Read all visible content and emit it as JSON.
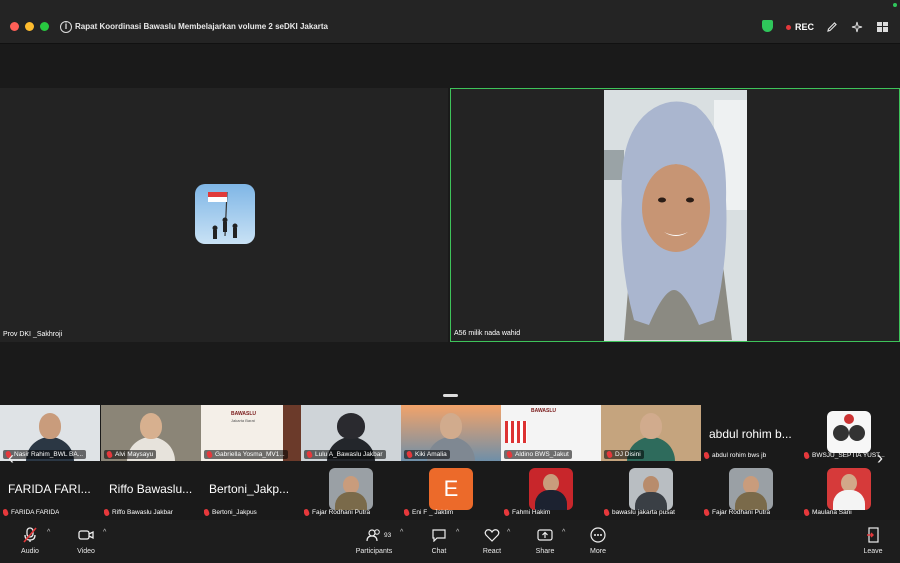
{
  "window": {
    "title": "Rapat Koordinasi Bawaslu Membelajarkan volume 2 seDKI Jakarta",
    "rec_label": "REC",
    "accent": "#3ec35a",
    "rec_color": "#e5383b"
  },
  "main_tiles": [
    {
      "name": "Prov DKI _Sakhroji"
    },
    {
      "name": "A56 milik nada wahid"
    }
  ],
  "gallery": {
    "row1": [
      "Nasir Rahim_BWL BA...",
      "Alvi Maysayu",
      "Gabriella Yosma_MV1...",
      "Lulu A_Bawaslu Jakbar",
      "Kiki Amalia",
      "Aldino BWS_Jakut",
      "DJ Disini",
      "abdul rohim bws jb",
      "BWSJU_SEPTIA YUST..."
    ],
    "row1_big": "abdul rohim b...",
    "row2": [
      {
        "big": "FARIDA FARI...",
        "name": "FARIDA FARIDA"
      },
      {
        "big": "Riffo Bawaslu...",
        "name": "Riffo Bawaslu Jakbar"
      },
      {
        "big": "Bertoni_Jakp...",
        "name": "Bertoni_Jakpus"
      },
      {
        "big": "",
        "name": "Fajar Rodhani Putra"
      },
      {
        "big": "E",
        "name": "Eni F _ Jaktim"
      },
      {
        "big": "",
        "name": "Fahmi Hakim"
      },
      {
        "big": "",
        "name": "bawaslu jakarta pusat"
      },
      {
        "big": "",
        "name": "Fajar Rodhani Putra"
      },
      {
        "big": "",
        "name": "Maulana Sani"
      }
    ],
    "logo_text": "BAWASLU",
    "logo_sub": "Jakarta Barat"
  },
  "toolbar": {
    "audio": "Audio",
    "video": "Video",
    "participants": "Participants",
    "participants_count": "93",
    "chat": "Chat",
    "react": "React",
    "share": "Share",
    "more": "More",
    "leave": "Leave"
  }
}
